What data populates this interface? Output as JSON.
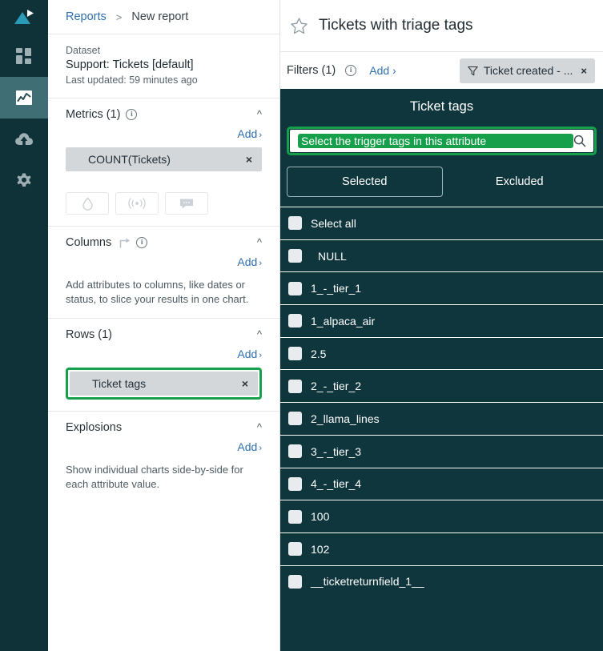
{
  "rail": {
    "logo_name": "logo-icon",
    "items": [
      {
        "icon": "dashboard-grid-icon",
        "active": false
      },
      {
        "icon": "analytics-chart-icon",
        "active": true
      },
      {
        "icon": "cloud-upload-icon",
        "active": false
      },
      {
        "icon": "settings-gear-icon",
        "active": false
      }
    ]
  },
  "breadcrumb": {
    "link": "Reports",
    "separator": ">",
    "current": "New report"
  },
  "dataset": {
    "label": "Dataset",
    "name": "Support: Tickets [default]",
    "updated": "Last updated: 59 minutes ago"
  },
  "metrics": {
    "title": "Metrics (1)",
    "add_label": "Add",
    "chips": [
      "COUNT(Tickets)"
    ],
    "buttons": [
      "droplet-icon",
      "broadcast-icon",
      "comment-icon"
    ]
  },
  "columns": {
    "title": "Columns",
    "add_label": "Add",
    "help": "Add attributes to columns, like dates or status, to slice your results in one chart."
  },
  "rows": {
    "title": "Rows (1)",
    "add_label": "Add",
    "chips": [
      "Ticket tags"
    ]
  },
  "explosions": {
    "title": "Explosions",
    "add_label": "Add",
    "help": "Show individual charts side-by-side for each attribute value."
  },
  "report": {
    "title": "Tickets with triage tags",
    "star_icon": "star-outline-icon"
  },
  "filters": {
    "label": "Filters (1)",
    "add_label": "Add",
    "chip": "Ticket created - ..."
  },
  "modal": {
    "title": "Ticket tags",
    "search_value": "Select the trigger tags in this attribute",
    "tabs": [
      {
        "label": "Selected",
        "active": true
      },
      {
        "label": "Excluded",
        "active": false
      }
    ],
    "items": [
      {
        "label": "Select all",
        "indent": false
      },
      {
        "label": "NULL",
        "indent": true
      },
      {
        "label": "1_-_tier_1",
        "indent": false
      },
      {
        "label": "1_alpaca_air",
        "indent": false
      },
      {
        "label": "2.5",
        "indent": false
      },
      {
        "label": "2_-_tier_2",
        "indent": false
      },
      {
        "label": "2_llama_lines",
        "indent": false
      },
      {
        "label": "3_-_tier_3",
        "indent": false
      },
      {
        "label": "4_-_tier_4",
        "indent": false
      },
      {
        "label": "100",
        "indent": false
      },
      {
        "label": "102",
        "indent": false
      },
      {
        "label": "__ticketreturnfield_1__",
        "indent": false
      }
    ]
  },
  "colors": {
    "rail_bg": "#0f3239",
    "rail_active": "#3f6f75",
    "modal_bg": "#0f363d",
    "accent_link": "#2f6fad",
    "highlight_green": "#17a04b",
    "chip_bg": "#d3d7da",
    "logo_teal": "#2a9cb8"
  }
}
